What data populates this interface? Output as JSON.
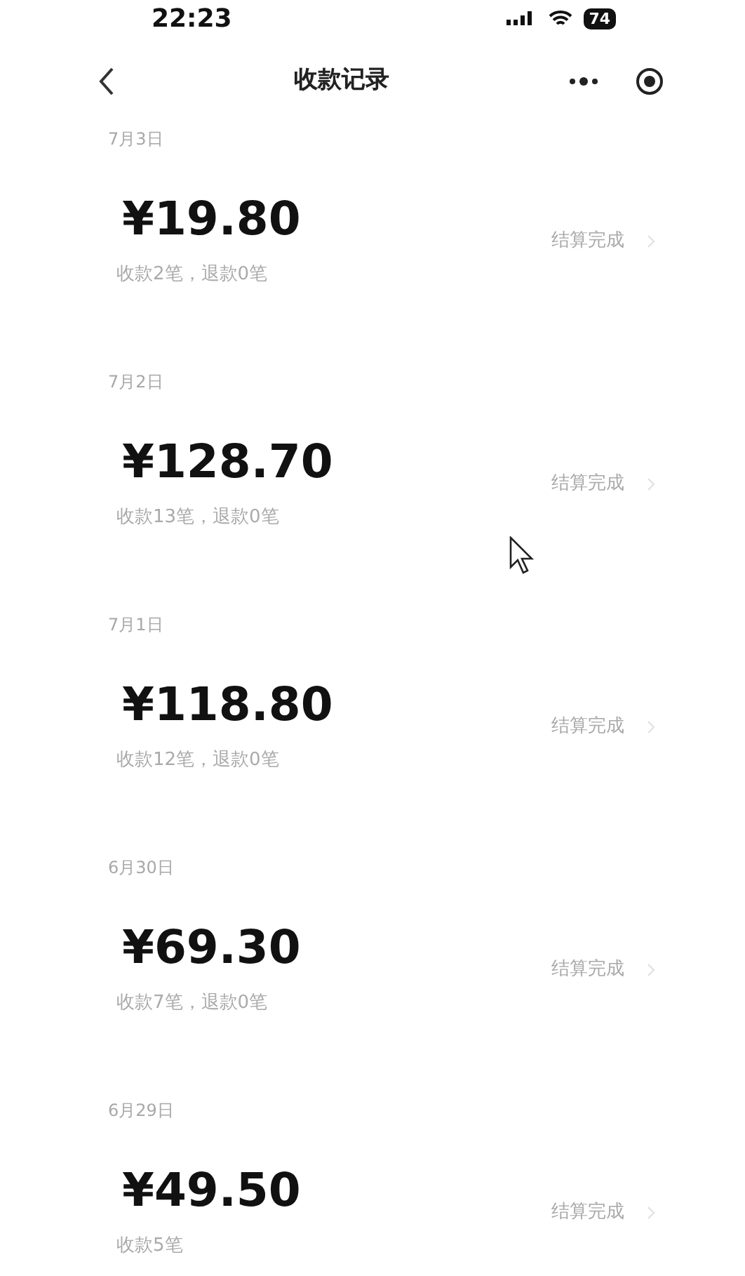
{
  "status_bar": {
    "time": "22:23",
    "battery": "74"
  },
  "header": {
    "title": "收款记录"
  },
  "records": [
    {
      "date": "7月3日",
      "amount": "¥19.80",
      "summary": "收款2笔，退款0笔",
      "status": "结算完成"
    },
    {
      "date": "7月2日",
      "amount": "¥128.70",
      "summary": "收款13笔，退款0笔",
      "status": "结算完成"
    },
    {
      "date": "7月1日",
      "amount": "¥118.80",
      "summary": "收款12笔，退款0笔",
      "status": "结算完成"
    },
    {
      "date": "6月30日",
      "amount": "¥69.30",
      "summary": "收款7笔，退款0笔",
      "status": "结算完成"
    },
    {
      "date": "6月29日",
      "amount": "¥49.50",
      "summary": "收款5笔",
      "status": "结算完成"
    }
  ]
}
